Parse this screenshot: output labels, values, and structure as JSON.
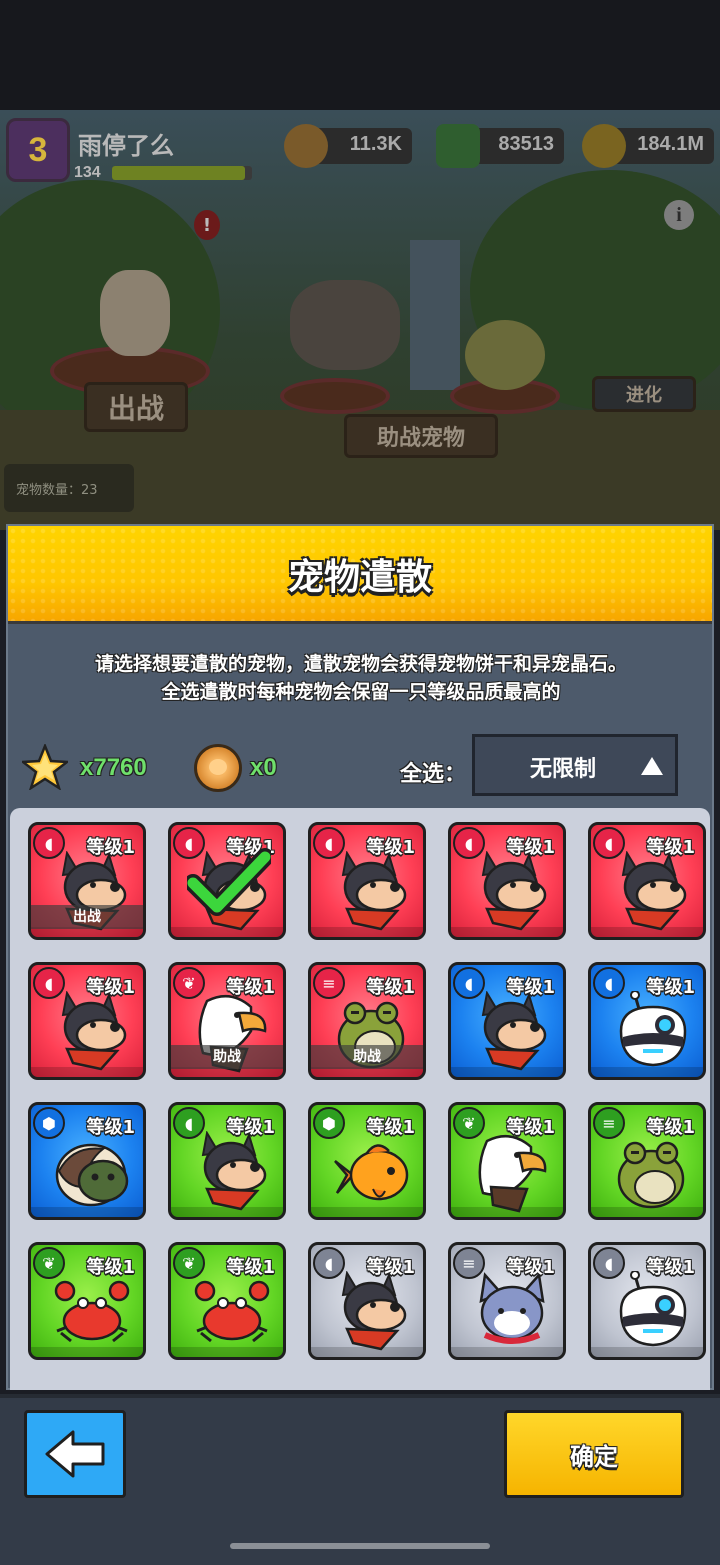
{
  "player": {
    "name": "雨停了么",
    "level": "3",
    "xp": "134",
    "xp_fraction": 0.95
  },
  "resources": [
    {
      "icon": "cookie-coin-icon",
      "value": "11.3K",
      "color": "#c88a2e"
    },
    {
      "icon": "green-gem-icon",
      "value": "83513",
      "color": "#3c9a3c"
    },
    {
      "icon": "gold-coin-icon",
      "value": "184.1M",
      "color": "#c79a1e"
    }
  ],
  "scene": {
    "fight_button": "出战",
    "assist_button": "助战宠物",
    "evolve_button": "进化",
    "pet_count": "宠物数量：23"
  },
  "modal": {
    "title": "宠物遣散",
    "description_line1": "请选择想要遣散的宠物，遣散宠物会获得宠物饼干和异宠晶石。",
    "description_line2": "全选遣散时每种宠物会保留一只等级品质最高的",
    "star_crystal_count": "x7760",
    "cookie_count": "x0",
    "select_all_label": "全选：",
    "select_all_value": "无限制"
  },
  "pets": [
    {
      "rarity": "red",
      "type_icon": "dog-paw-icon",
      "species": "dog",
      "level": "等级1",
      "tag": "出战",
      "selected": false
    },
    {
      "rarity": "red",
      "type_icon": "dog-paw-icon",
      "species": "dog",
      "level": "等级1",
      "tag": "",
      "selected": true
    },
    {
      "rarity": "red",
      "type_icon": "dog-paw-icon",
      "species": "dog",
      "level": "等级1",
      "tag": "",
      "selected": false
    },
    {
      "rarity": "red",
      "type_icon": "dog-paw-icon",
      "species": "dog",
      "level": "等级1",
      "tag": "",
      "selected": false
    },
    {
      "rarity": "red",
      "type_icon": "dog-paw-icon",
      "species": "dog",
      "level": "等级1",
      "tag": "",
      "selected": false
    },
    {
      "rarity": "red",
      "type_icon": "dog-paw-icon",
      "species": "dog",
      "level": "等级1",
      "tag": "",
      "selected": false
    },
    {
      "rarity": "red",
      "type_icon": "bird-icon",
      "species": "eagle",
      "level": "等级1",
      "tag": "助战",
      "selected": false
    },
    {
      "rarity": "red",
      "type_icon": "coin-stack-icon",
      "species": "frog",
      "level": "等级1",
      "tag": "助战",
      "selected": false
    },
    {
      "rarity": "blue",
      "type_icon": "dog-paw-icon",
      "species": "dog",
      "level": "等级1",
      "tag": "",
      "selected": false
    },
    {
      "rarity": "blue",
      "type_icon": "dog-paw-icon",
      "species": "robot",
      "level": "等级1",
      "tag": "",
      "selected": false
    },
    {
      "rarity": "blue",
      "type_icon": "turtle-shell-icon",
      "species": "turtle",
      "level": "等级1",
      "tag": "",
      "selected": false
    },
    {
      "rarity": "green",
      "type_icon": "dog-paw-icon",
      "species": "dog",
      "level": "等级1",
      "tag": "",
      "selected": false
    },
    {
      "rarity": "green",
      "type_icon": "turtle-shell-icon",
      "species": "fish",
      "level": "等级1",
      "tag": "",
      "selected": false
    },
    {
      "rarity": "green",
      "type_icon": "bird-icon",
      "species": "eagle",
      "level": "等级1",
      "tag": "",
      "selected": false
    },
    {
      "rarity": "green",
      "type_icon": "coin-stack-icon",
      "species": "frog",
      "level": "等级1",
      "tag": "",
      "selected": false
    },
    {
      "rarity": "green",
      "type_icon": "bird-icon",
      "species": "crab",
      "level": "等级1",
      "tag": "",
      "selected": false
    },
    {
      "rarity": "green",
      "type_icon": "bird-icon",
      "species": "crab",
      "level": "等级1",
      "tag": "",
      "selected": false
    },
    {
      "rarity": "gray",
      "type_icon": "dog-paw-icon",
      "species": "dog",
      "level": "等级1",
      "tag": "",
      "selected": false
    },
    {
      "rarity": "gray",
      "type_icon": "coin-stack-icon",
      "species": "cat",
      "level": "等级1",
      "tag": "",
      "selected": false
    },
    {
      "rarity": "gray",
      "type_icon": "dog-paw-icon",
      "species": "robot",
      "level": "等级1",
      "tag": "",
      "selected": false
    }
  ],
  "footer": {
    "confirm_label": "确定",
    "back_icon": "back-arrow-icon"
  }
}
